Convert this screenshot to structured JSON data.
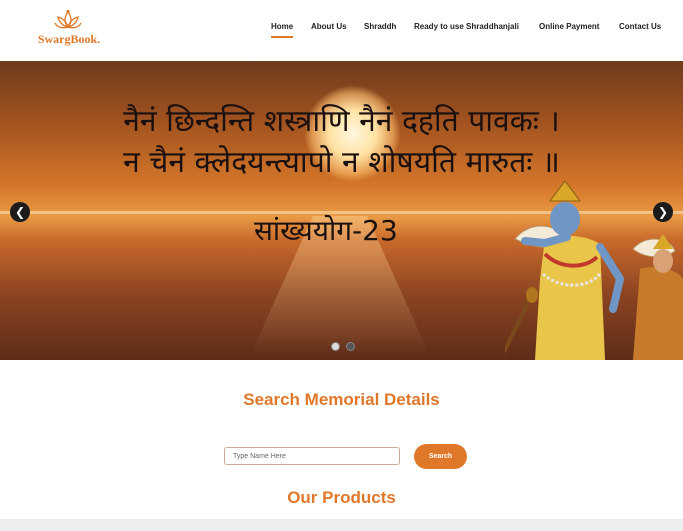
{
  "brand": {
    "name": "SwargBook.",
    "color": "#e0782a"
  },
  "nav": {
    "items": [
      {
        "label": "Home",
        "active": true
      },
      {
        "label": "About Us"
      },
      {
        "label": "Shraddh"
      },
      {
        "label": "Ready to use Shraddhanjali"
      },
      {
        "label": "Online Payment"
      },
      {
        "label": "Contact Us"
      }
    ]
  },
  "hero": {
    "verse_line1": "नैनं छिन्दन्ति शस्त्राणि नैनं दहति पावकः ।",
    "verse_line2": "न चैनं क्लेदयन्त्यापो न शोषयति मारुतः ॥",
    "chapter": "सांख्ययोग-23",
    "prev_icon": "chevron-left-icon",
    "next_icon": "chevron-right-icon",
    "slide_count": 2,
    "active_slide": 1
  },
  "search": {
    "title": "Search Memorial Details",
    "placeholder": "Type Name Here",
    "button_label": "Search"
  },
  "products": {
    "title": "Our Products"
  }
}
